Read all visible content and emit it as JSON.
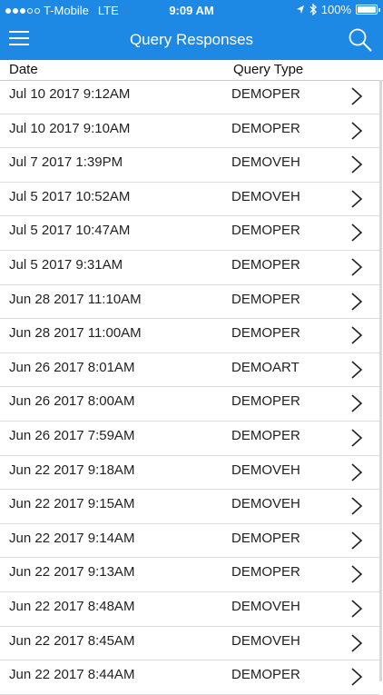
{
  "status_bar": {
    "carrier": "T-Mobile",
    "network": "LTE",
    "time": "9:09 AM",
    "battery": "100%",
    "battery_level": 1.0
  },
  "header": {
    "title": "Query Responses"
  },
  "columns": {
    "date": "Date",
    "query_type": "Query Type"
  },
  "rows": [
    {
      "date": "Jul 10 2017 9:12AM",
      "type": "DEMOPER"
    },
    {
      "date": "Jul 10 2017 9:10AM",
      "type": "DEMOPER"
    },
    {
      "date": "Jul 7 2017 1:39PM",
      "type": "DEMOVEH"
    },
    {
      "date": "Jul 5 2017 10:52AM",
      "type": "DEMOVEH"
    },
    {
      "date": "Jul 5 2017 10:47AM",
      "type": "DEMOPER"
    },
    {
      "date": "Jul 5 2017 9:31AM",
      "type": "DEMOPER"
    },
    {
      "date": "Jun 28 2017 11:10AM",
      "type": "DEMOPER"
    },
    {
      "date": "Jun 28 2017 11:00AM",
      "type": "DEMOPER"
    },
    {
      "date": "Jun 26 2017 8:01AM",
      "type": "DEMOART"
    },
    {
      "date": "Jun 26 2017 8:00AM",
      "type": "DEMOPER"
    },
    {
      "date": "Jun 26 2017 7:59AM",
      "type": "DEMOPER"
    },
    {
      "date": "Jun 22 2017 9:18AM",
      "type": "DEMOVEH"
    },
    {
      "date": "Jun 22 2017 9:15AM",
      "type": "DEMOVEH"
    },
    {
      "date": "Jun 22 2017 9:14AM",
      "type": "DEMOPER"
    },
    {
      "date": "Jun 22 2017 9:13AM",
      "type": "DEMOPER"
    },
    {
      "date": "Jun 22 2017 8:48AM",
      "type": "DEMOVEH"
    },
    {
      "date": "Jun 22 2017 8:45AM",
      "type": "DEMOVEH"
    },
    {
      "date": "Jun 22 2017 8:44AM",
      "type": "DEMOPER"
    }
  ],
  "icons": {
    "menu": "hamburger-menu-icon",
    "search": "search-icon",
    "chevron": "chevron-right-icon"
  },
  "colors": {
    "accent": "#1e88e5",
    "text": "#222222",
    "divider": "#dcdcdc"
  }
}
